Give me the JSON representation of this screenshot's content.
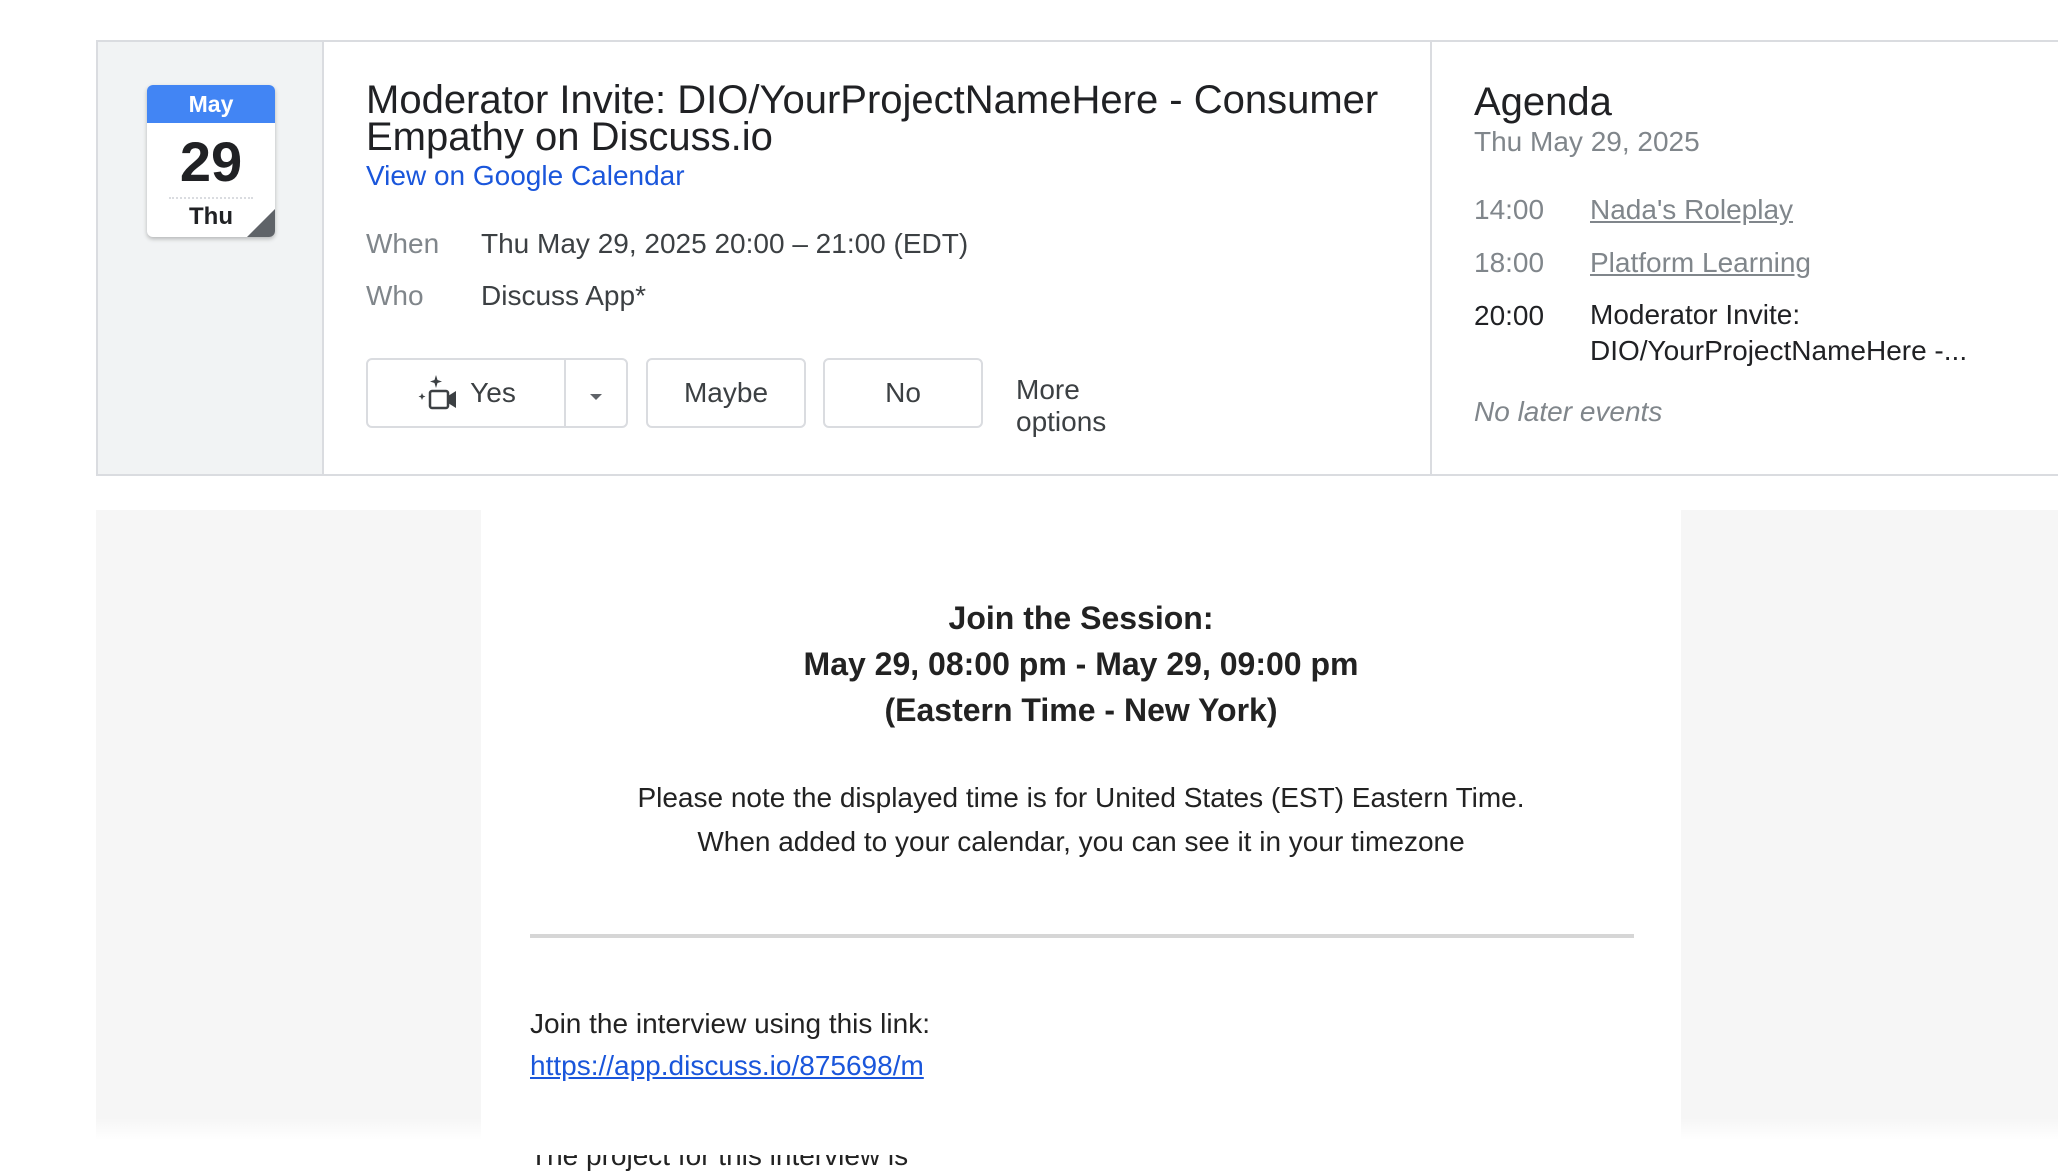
{
  "calendar_badge": {
    "month": "May",
    "day": "29",
    "weekday": "Thu"
  },
  "event": {
    "title": "Moderator Invite: DIO/YourProjectNameHere - Consumer Empathy on Discuss.io",
    "view_link": "View on Google Calendar",
    "when_label": "When",
    "when_value": "Thu May 29, 2025 20:00 – 21:00 (EDT)",
    "who_label": "Who",
    "who_value": "Discuss App*"
  },
  "rsvp": {
    "yes_label": "Yes",
    "maybe_label": "Maybe",
    "no_label": "No",
    "more_options_label": "More options"
  },
  "agenda": {
    "title": "Agenda",
    "date": "Thu May 29, 2025",
    "items": [
      {
        "time": "14:00",
        "name": "Nada's Roleplay"
      },
      {
        "time": "18:00",
        "name": "Platform Learning"
      },
      {
        "time": "20:00",
        "name": "Moderator Invite: DIO/YourProjectNameHere -..."
      }
    ],
    "no_later": "No later events"
  },
  "email_body": {
    "heading_line1": "Join the Session:",
    "heading_line2": "May 29, 08:00 pm - May 29, 09:00 pm",
    "heading_line3": "(Eastern Time - New York)",
    "note_line1": "Please note the displayed time is for United States (EST) Eastern Time.",
    "note_line2": "When added to your calendar, you can see it in your timezone",
    "join_text": "Join the interview using this link:",
    "join_link": "https://app.discuss.io/875698/m",
    "cut_text": "The project for this interview is"
  },
  "colors": {
    "brand_blue": "#4285f4",
    "link_blue": "#1a56db",
    "border": "#dadce0",
    "muted_text": "#80868b"
  }
}
